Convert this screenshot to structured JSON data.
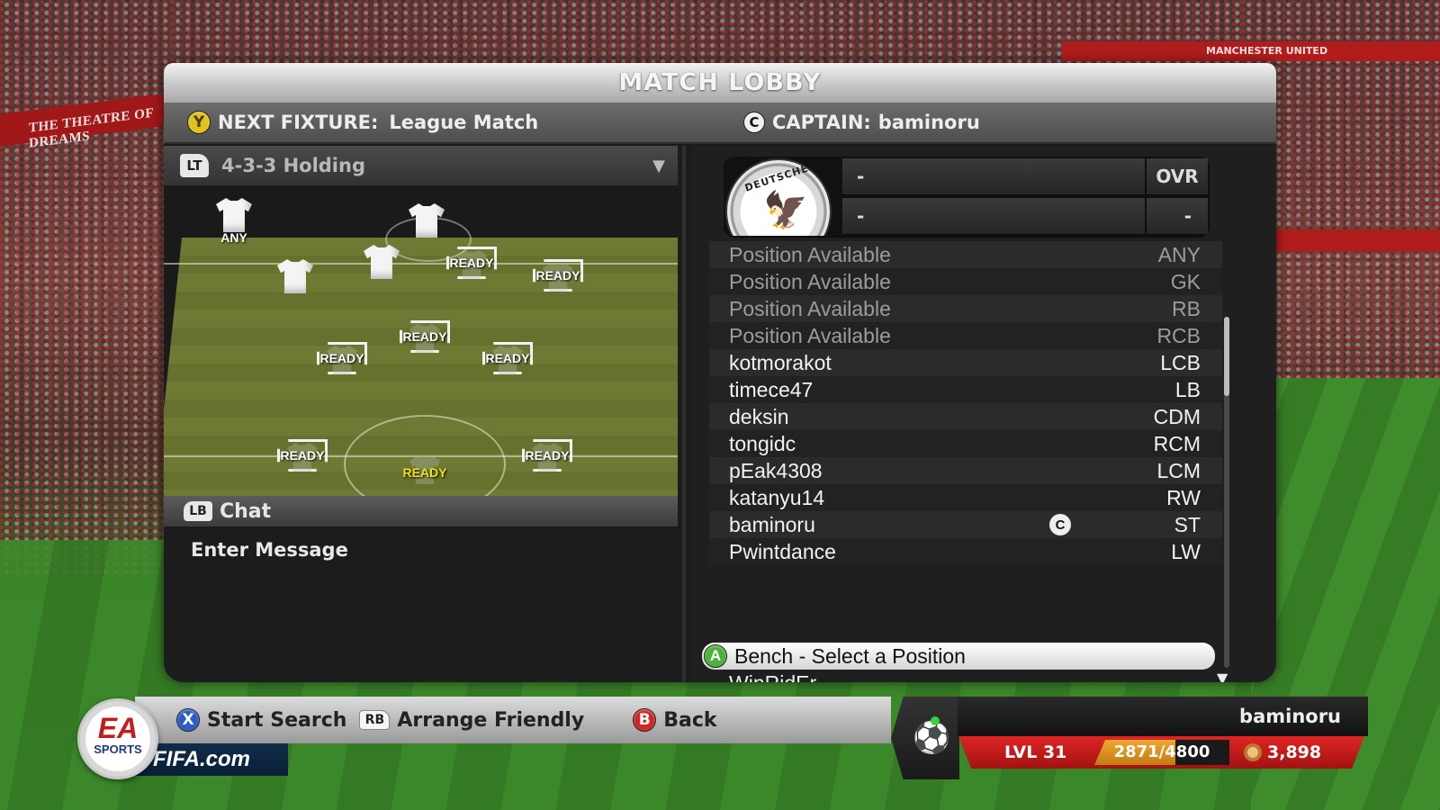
{
  "background": {
    "left_banner": "THE THEATRE OF DREAMS",
    "right_banner": "MANCHESTER UNITED"
  },
  "lobby": {
    "title": "MATCH LOBBY",
    "fixture": {
      "button": "Y",
      "label": "NEXT FIXTURE:",
      "value": "League Match"
    },
    "captain": {
      "button": "C",
      "label": "CAPTAIN:",
      "value": "baminoru"
    },
    "formation": {
      "button": "LT",
      "value": "4-3-3 Holding",
      "caret": "▼"
    },
    "pitch_players": [
      {
        "label": "ANY",
        "state": "shirt"
      },
      {
        "label": "",
        "state": "shirt"
      },
      {
        "label": "",
        "state": "shirt"
      },
      {
        "label": "",
        "state": "shirt"
      },
      {
        "label": "READY",
        "state": "ready"
      },
      {
        "label": "READY",
        "state": "ready"
      },
      {
        "label": "READY",
        "state": "ready"
      },
      {
        "label": "READY",
        "state": "ready"
      },
      {
        "label": "READY",
        "state": "ready"
      },
      {
        "label": "READY",
        "state": "ready"
      },
      {
        "label": "READY",
        "state": "ready"
      },
      {
        "label": "READY",
        "state": "ready-highlight"
      }
    ],
    "chat": {
      "button": "LB",
      "label": "Chat",
      "input_placeholder": "Enter Message"
    },
    "team_header": {
      "crest_text": "DEUTSCHER",
      "row1_name": "-",
      "row1_ovr": "OVR",
      "row2_name": "-",
      "row2_ovr": "-"
    },
    "roster": [
      {
        "name": "Position Available",
        "position": "ANY",
        "available": true,
        "captain": false
      },
      {
        "name": "Position Available",
        "position": "GK",
        "available": true,
        "captain": false
      },
      {
        "name": "Position Available",
        "position": "RB",
        "available": true,
        "captain": false
      },
      {
        "name": "Position Available",
        "position": "RCB",
        "available": true,
        "captain": false
      },
      {
        "name": "kotmorakot",
        "position": "LCB",
        "available": false,
        "captain": false
      },
      {
        "name": "timece47",
        "position": "LB",
        "available": false,
        "captain": false
      },
      {
        "name": "deksin",
        "position": "CDM",
        "available": false,
        "captain": false
      },
      {
        "name": "tongidc",
        "position": "RCM",
        "available": false,
        "captain": false
      },
      {
        "name": "pEak4308",
        "position": "LCM",
        "available": false,
        "captain": false
      },
      {
        "name": "katanyu14",
        "position": "RW",
        "available": false,
        "captain": false
      },
      {
        "name": "baminoru",
        "position": "ST",
        "available": false,
        "captain": true,
        "captain_mark": "C"
      },
      {
        "name": "Pwintdance",
        "position": "LW",
        "available": false,
        "captain": false
      }
    ],
    "bench": {
      "button": "A",
      "label": "Bench - Select a Position",
      "players": [
        "WinRidEr"
      ]
    },
    "scroll_arrow": "▼"
  },
  "hud": {
    "start_search": {
      "button": "X",
      "label": "Start Search"
    },
    "arrange_friendly": {
      "button": "RB",
      "label": "Arrange Friendly"
    },
    "back": {
      "button": "B",
      "label": "Back"
    },
    "ea_logo": {
      "ea": "EA",
      "sports": "SPORTS"
    },
    "fifa_com": "FIFA.com"
  },
  "profile": {
    "username": "baminoru",
    "level": "LVL 31",
    "xp_text": "2871/4800",
    "xp_progress": 0.598,
    "coins": "3,898",
    "status_icon": "player-kicking-icon",
    "online_color": "#37d23a"
  }
}
